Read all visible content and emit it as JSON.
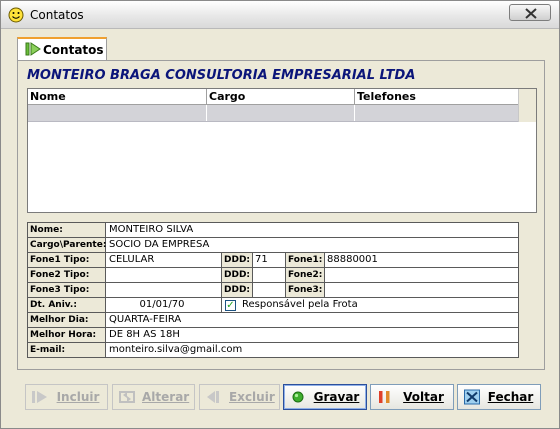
{
  "window": {
    "title": "Contatos"
  },
  "tab": {
    "label": "Contatos"
  },
  "company_name": "MONTEIRO BRAGA CONSULTORIA EMPRESARIAL LTDA",
  "grid": {
    "columns": [
      "Nome",
      "Cargo",
      "Telefones"
    ],
    "rows": [
      [
        "",
        "",
        ""
      ]
    ]
  },
  "form": {
    "nome": {
      "label": "Nome:",
      "value": "MONTEIRO SILVA"
    },
    "cargo": {
      "label": "Cargo\\Parente:",
      "value": "SOCIO DA EMPRESA"
    },
    "fone1": {
      "tipo_label": "Fone1 Tipo:",
      "tipo": "CELULAR",
      "ddd_label": "DDD:",
      "ddd": "71",
      "fone_label": "Fone1:",
      "fone": "88880001"
    },
    "fone2": {
      "tipo_label": "Fone2 Tipo:",
      "tipo": "",
      "ddd_label": "DDD:",
      "ddd": "",
      "fone_label": "Fone2:",
      "fone": ""
    },
    "fone3": {
      "tipo_label": "Fone3 Tipo:",
      "tipo": "",
      "ddd_label": "DDD:",
      "ddd": "",
      "fone_label": "Fone3:",
      "fone": ""
    },
    "aniv": {
      "label": "Dt. Aniv.:",
      "value": "01/01/70",
      "checkbox_label": "Responsável pela Frota",
      "checked": true
    },
    "melhor_dia": {
      "label": "Melhor Dia:",
      "value": "QUARTA-FEIRA"
    },
    "melhor_hora": {
      "label": "Melhor Hora:",
      "value": "DE 8H AS 18H"
    },
    "email": {
      "label": "E-mail:",
      "value": "monteiro.silva@gmail.com"
    }
  },
  "buttons": {
    "incluir": {
      "label": "Incluir",
      "enabled": false,
      "icon": "play-icon"
    },
    "alterar": {
      "label": "Alterar",
      "enabled": false,
      "icon": "refresh-icon"
    },
    "excluir": {
      "label": "Excluir",
      "enabled": false,
      "icon": "delete-icon"
    },
    "gravar": {
      "label": "Gravar",
      "enabled": true,
      "icon": "green-dot-icon"
    },
    "voltar": {
      "label": "Voltar",
      "enabled": true,
      "icon": "pause-icon"
    },
    "fechar": {
      "label": "Fechar",
      "enabled": true,
      "icon": "x-box-icon"
    }
  },
  "colors": {
    "company": "#0b157a",
    "tab_accent": "#f0a030",
    "grid_row": "#d3d3d8"
  }
}
